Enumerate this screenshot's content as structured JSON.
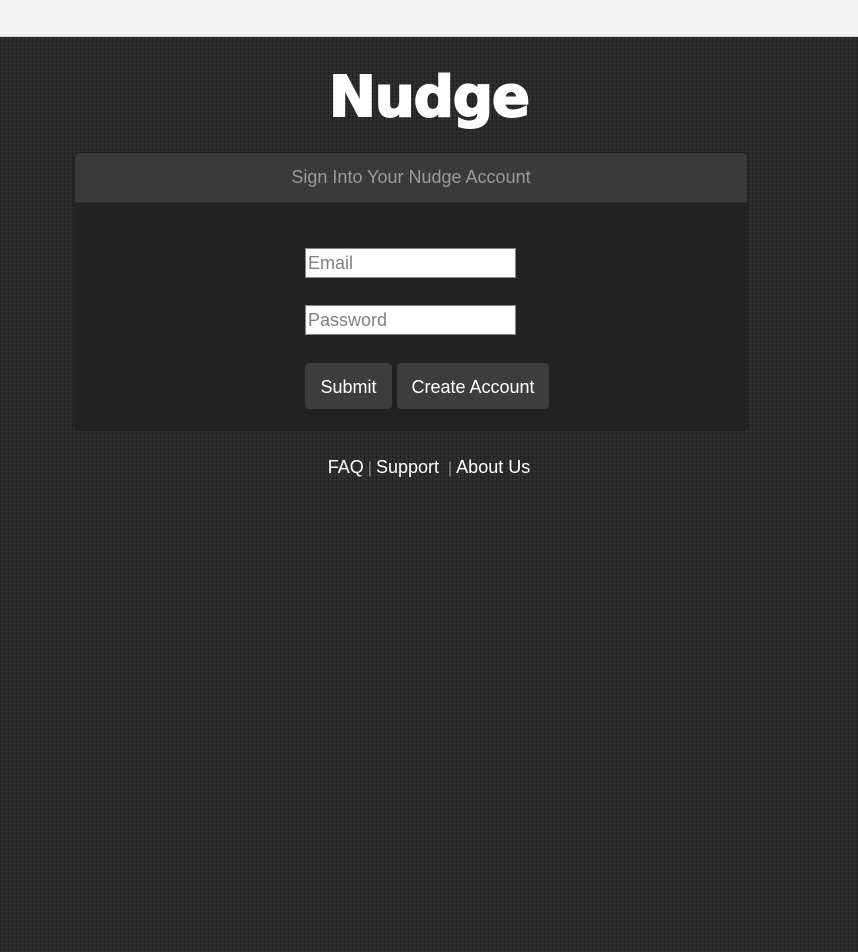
{
  "logo": {
    "text": "Nudge"
  },
  "login_card": {
    "header": "Sign Into Your Nudge Account",
    "email_placeholder": "Email",
    "password_placeholder": "Password",
    "submit_label": "Submit",
    "create_account_label": "Create Account"
  },
  "footer": {
    "links": [
      {
        "label": "FAQ"
      },
      {
        "label": "Support"
      },
      {
        "label": "About Us"
      }
    ],
    "separator": "|"
  },
  "colors": {
    "background": "#2b2b2b",
    "card": "#222222",
    "card_header": "#3a3a3a",
    "button": "#3d3d3d",
    "text": "#ffffff"
  }
}
